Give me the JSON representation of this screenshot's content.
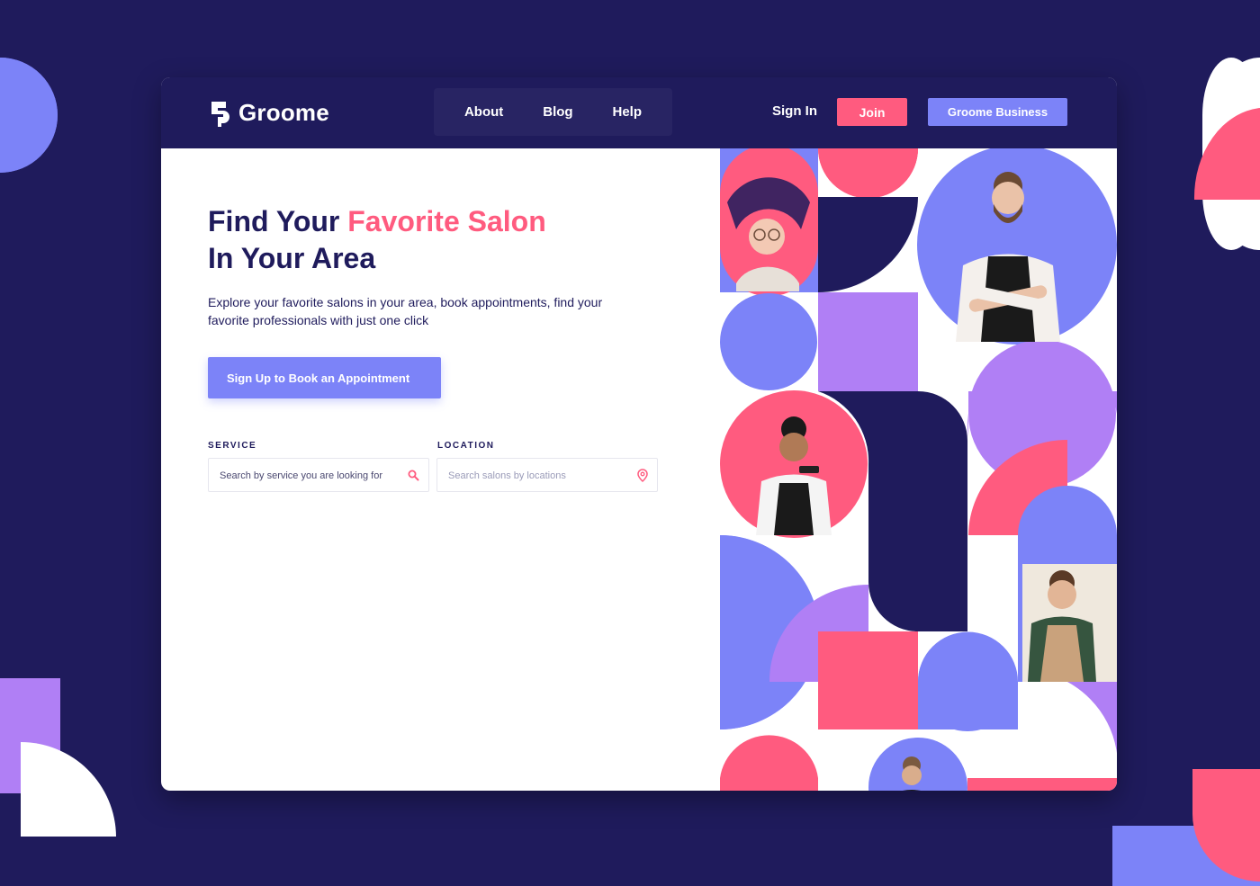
{
  "brand": {
    "name": "Groome",
    "colors": {
      "navy": "#1f1b5c",
      "pink": "#ff5b7f",
      "periwinkle": "#7c83f8",
      "lavender": "#b07ff5"
    }
  },
  "nav": {
    "links": [
      "About",
      "Blog",
      "Help"
    ],
    "sign_in": "Sign In",
    "join": "Join",
    "business": "Groome Business"
  },
  "hero": {
    "title_part1": "Find Your ",
    "title_accent": "Favorite Salon",
    "title_part2": "In Your Area",
    "description": "Explore your favorite salons in your area, book appointments, find your favorite professionals with just one click",
    "cta": "Sign Up to Book an Appointment"
  },
  "search": {
    "service_label": "SERVICE",
    "service_placeholder": "Search by service you are looking for",
    "service_icon": "search-icon",
    "location_label": "LOCATION",
    "location_placeholder": "Search salons by locations",
    "location_icon": "map-pin-icon"
  }
}
